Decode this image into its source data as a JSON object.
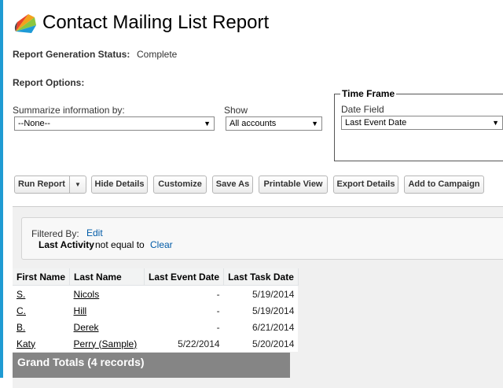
{
  "header": {
    "title": "Contact Mailing List Report"
  },
  "status": {
    "label": "Report Generation Status:",
    "value": "Complete"
  },
  "options": {
    "label": "Report Options:",
    "summarize": {
      "label": "Summarize information by:",
      "value": "--None--"
    },
    "show": {
      "label": "Show",
      "value": "All accounts"
    },
    "time_frame": {
      "legend": "Time Frame",
      "date_field_label": "Date Field",
      "date_field_value": "Last Event Date"
    }
  },
  "toolbar": {
    "run_report": "Run Report",
    "hide_details": "Hide Details",
    "customize": "Customize",
    "save_as": "Save As",
    "printable_view": "Printable View",
    "export_details": "Export Details",
    "add_to_campaign": "Add to Campaign"
  },
  "filter": {
    "label": "Filtered By:",
    "edit": "Edit",
    "field": "Last Activity",
    "operator": "not equal to",
    "clear": "Clear"
  },
  "table": {
    "headers": [
      "First Name",
      "Last Name",
      "Last Event Date",
      "Last Task Date"
    ],
    "rows": [
      {
        "first": "S.",
        "last": "Nicols",
        "event": "-",
        "task": "5/19/2014"
      },
      {
        "first": "C.",
        "last": "Hill",
        "event": "-",
        "task": "5/19/2014"
      },
      {
        "first": "B.",
        "last": "Derek",
        "event": "-",
        "task": "6/21/2014"
      },
      {
        "first": "Katy",
        "last": "Perry (Sample)",
        "event": "5/22/2014",
        "task": "5/20/2014"
      }
    ]
  },
  "totals": {
    "label": "Grand Totals (4 records)"
  }
}
